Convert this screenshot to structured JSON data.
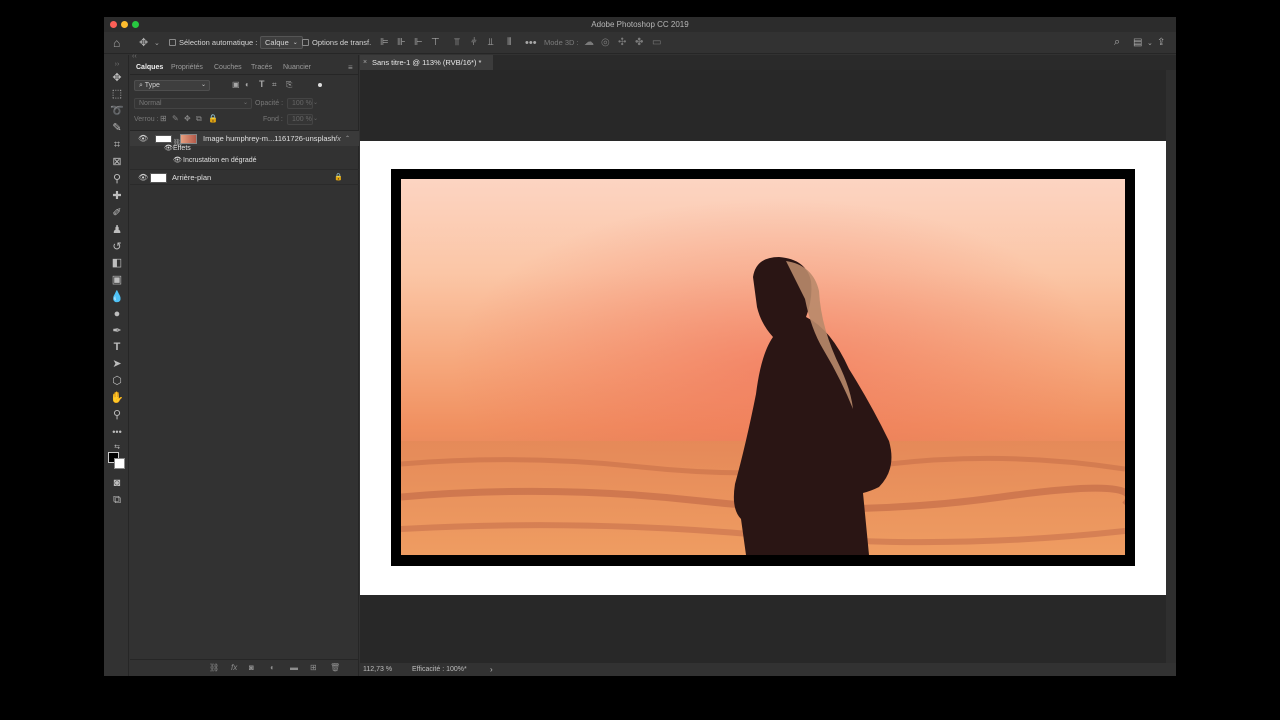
{
  "window": {
    "title": "Adobe Photoshop CC 2019"
  },
  "colors": {
    "close": "#fd5f57",
    "minimize": "#fdbc2e",
    "maximize": "#27c840",
    "accent": "#f6a37a"
  },
  "options_bar": {
    "auto_select_label": "Sélection automatique :",
    "auto_select_target": "Calque",
    "transform_label": "Options de transf.",
    "mode_3d_label": "Mode 3D :"
  },
  "panel": {
    "tabs": [
      "Calques",
      "Propriétés",
      "Couches",
      "Tracés",
      "Nuancier"
    ],
    "filter_type": "Type",
    "blend_mode": "Normal",
    "opacity_label": "Opacité :",
    "opacity_value": "100 %",
    "lock_label": "Verrou :",
    "fill_label": "Fond :",
    "fill_value": "100 %",
    "layers": [
      {
        "name": "Image humphrey-m...1161726-unsplash",
        "fx": "fx"
      },
      {
        "name": "Effets"
      },
      {
        "name": "Incrustation en dégradé"
      },
      {
        "name": "Arrière-plan"
      }
    ]
  },
  "document": {
    "tab_title": "Sans titre-1 @ 113% (RVB/16*) *"
  },
  "status": {
    "zoom": "112,73 %",
    "efficiency": "Efficacité : 100%*",
    "arrow": "›"
  }
}
